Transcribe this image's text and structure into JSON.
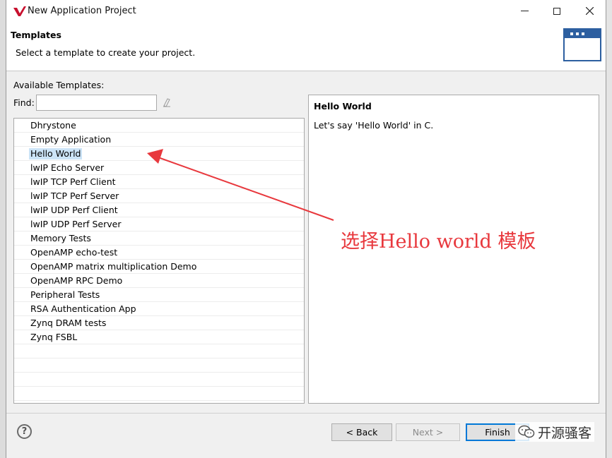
{
  "window": {
    "title": "New Application Project"
  },
  "header": {
    "title": "Templates",
    "subtitle": "Select a template to create your project."
  },
  "filter": {
    "available_label": "Available Templates:",
    "find_label": "Find:",
    "find_value": "",
    "find_placeholder": ""
  },
  "templates": [
    "Dhrystone",
    "Empty Application",
    "Hello World",
    "lwIP Echo Server",
    "lwIP TCP Perf Client",
    "lwIP TCP Perf Server",
    "lwIP UDP Perf Client",
    "lwIP UDP Perf Server",
    "Memory Tests",
    "OpenAMP echo-test",
    "OpenAMP matrix multiplication Demo",
    "OpenAMP RPC Demo",
    "Peripheral Tests",
    "RSA Authentication App",
    "Zynq DRAM tests",
    "Zynq FSBL"
  ],
  "selected_template": "Hello World",
  "description": {
    "title": "Hello World",
    "text": "Let's say 'Hello World' in C."
  },
  "buttons": {
    "help": "?",
    "back": "< Back",
    "next": "Next >",
    "finish": "Finish"
  },
  "annotation": {
    "text": "选择Hello world 模板",
    "color": "#e8383d"
  },
  "watermark": {
    "text": "开源骚客"
  },
  "colors": {
    "accent": "#0078d7",
    "selection": "#cce4f7",
    "brand_icon": "#2d5fa0"
  }
}
